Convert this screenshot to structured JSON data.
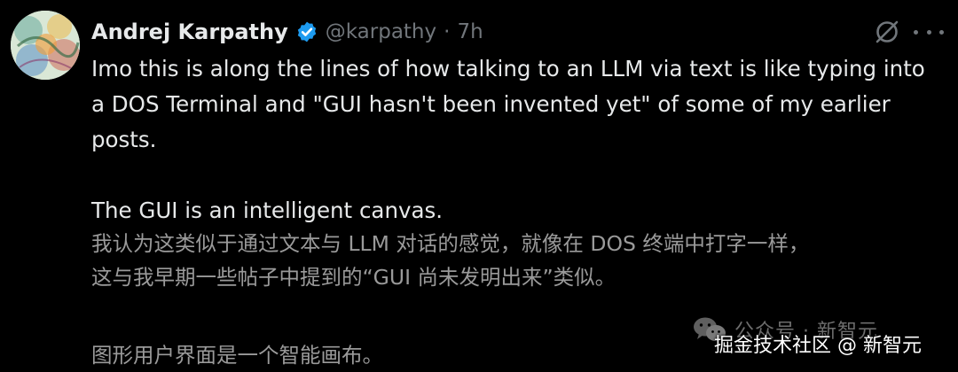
{
  "author": {
    "name": "Andrej Karpathy",
    "handle": "@karpathy",
    "separator": "·",
    "time": "7h",
    "verified_color": "#1d9bf0"
  },
  "tweet": {
    "line1": "Imo this is along the lines of how talking to an LLM via text is like typing into",
    "line2": "a DOS Terminal and \"GUI hasn't been invented yet\" of some of my earlier",
    "line3": "posts.",
    "line4": "The GUI is an intelligent canvas."
  },
  "translation": {
    "line1": "我认为这类似于通过文本与 LLM 对话的感觉，就像在 DOS 终端中打字一样，",
    "line2": "这与我早期一些帖子中提到的“GUI 尚未发明出来”类似。",
    "line3": "图形用户界面是一个智能画布。"
  },
  "watermark": {
    "top": "公众号 · 新智元",
    "bottom": "掘金技术社区 @ 新智元"
  },
  "icons": {
    "grok": "grok-icon",
    "more": "more-icon",
    "verified": "verified-badge-icon",
    "wechat": "wechat-icon"
  },
  "colors": {
    "background": "#000000",
    "text": "#e7e9ea",
    "muted": "#71767b",
    "translation": "#9a9a9a"
  }
}
